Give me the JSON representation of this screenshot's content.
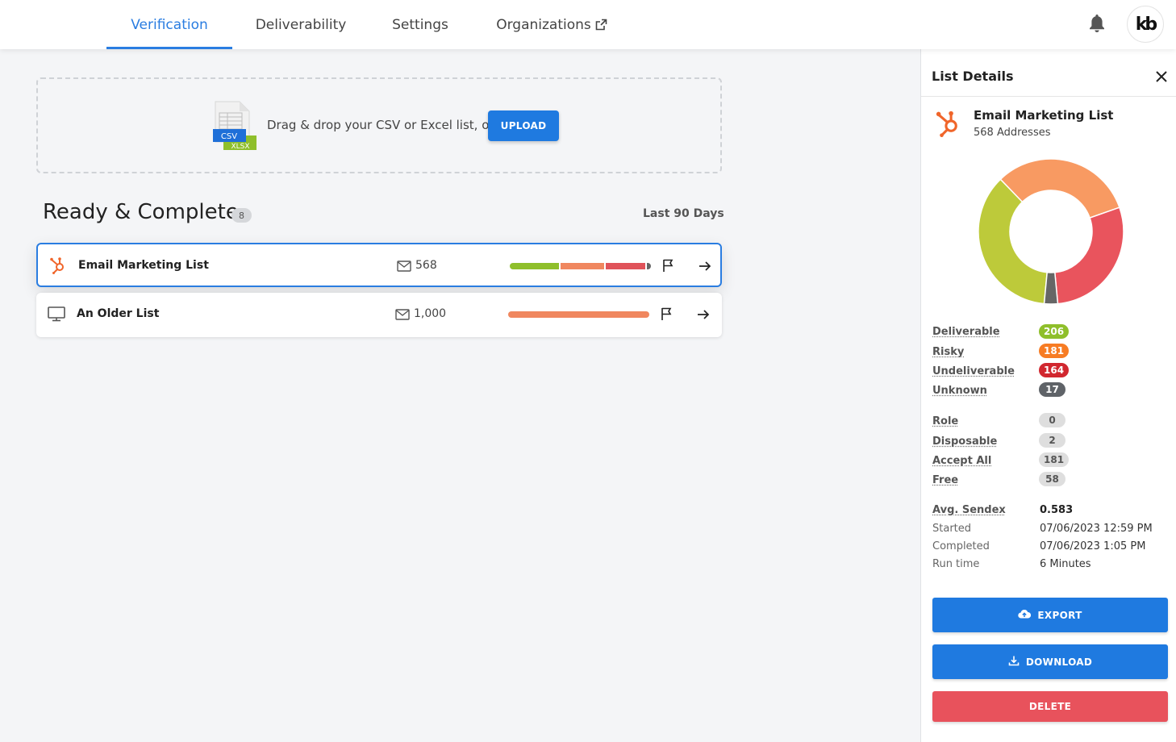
{
  "nav": {
    "tabs": [
      {
        "label": "Verification",
        "active": true
      },
      {
        "label": "Deliverability",
        "active": false
      },
      {
        "label": "Settings",
        "active": false
      },
      {
        "label": "Organizations",
        "active": false,
        "external": true
      }
    ],
    "bell_icon": "bell-icon",
    "avatar_text": "kb"
  },
  "upload": {
    "prompt": "Drag & drop your CSV or Excel list, or",
    "button_label": "UPLOAD",
    "file_icon_labels": [
      "CSV",
      "XLSX"
    ]
  },
  "section": {
    "title": "Ready & Complete",
    "count": "8",
    "period": "Last 90 Days"
  },
  "lists": [
    {
      "name": "Email Marketing List",
      "source_icon": "hubspot-icon",
      "count": "568",
      "selected": true,
      "breakdown": [
        {
          "status": "Deliverable",
          "value": 206,
          "color": "#8fbf2b"
        },
        {
          "status": "Risky",
          "value": 181,
          "color": "#f0875f"
        },
        {
          "status": "Undeliverable",
          "value": 164,
          "color": "#e0535a"
        },
        {
          "status": "Unknown",
          "value": 17,
          "color": "#666666"
        }
      ]
    },
    {
      "name": "An Older List",
      "source_icon": "monitor-icon",
      "count": "1,000",
      "selected": false,
      "breakdown": [
        {
          "status": "Risky",
          "value": 1000,
          "color": "#f0875f"
        }
      ]
    }
  ],
  "panel": {
    "title": "List Details",
    "list_name": "Email Marketing List",
    "list_sub": "568 Addresses",
    "chart_data": {
      "type": "pie",
      "categories": [
        "Deliverable",
        "Risky",
        "Undeliverable",
        "Unknown"
      ],
      "values": [
        206,
        181,
        164,
        17
      ],
      "colors": [
        "#bdca3a",
        "#f89a62",
        "#e9545d",
        "#666666"
      ]
    },
    "statuses": [
      {
        "label": "Deliverable",
        "value": "206",
        "bg": "#8fbf2b",
        "fg": "#ffffff"
      },
      {
        "label": "Risky",
        "value": "181",
        "bg": "#f77c24",
        "fg": "#ffffff"
      },
      {
        "label": "Undeliverable",
        "value": "164",
        "bg": "#d1272f",
        "fg": "#ffffff"
      },
      {
        "label": "Unknown",
        "value": "17",
        "bg": "#5f6368",
        "fg": "#ffffff"
      }
    ],
    "flags": [
      {
        "label": "Role",
        "value": "0"
      },
      {
        "label": "Disposable",
        "value": "2"
      },
      {
        "label": "Accept All",
        "value": "181"
      },
      {
        "label": "Free",
        "value": "58"
      }
    ],
    "sendex": {
      "label": "Avg. Sendex",
      "value": "0.583"
    },
    "details": [
      {
        "label": "Started",
        "value": "07/06/2023 12:59 PM"
      },
      {
        "label": "Completed",
        "value": "07/06/2023 1:05 PM"
      },
      {
        "label": "Run time",
        "value": "6 Minutes"
      }
    ],
    "buttons": {
      "export": "EXPORT",
      "download": "DOWNLOAD",
      "delete": "DELETE"
    }
  }
}
